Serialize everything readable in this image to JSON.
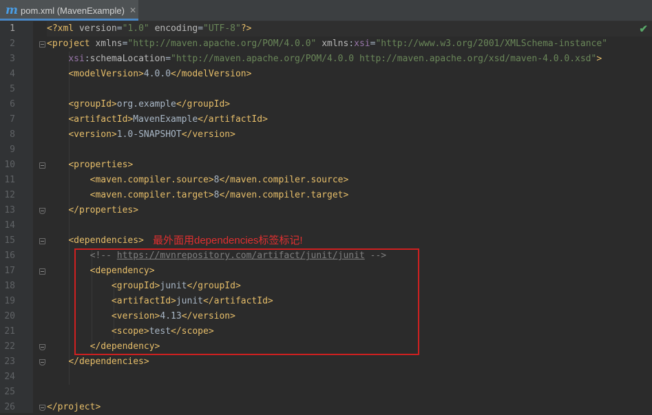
{
  "tab": {
    "icon": "maven-m-icon",
    "icon_glyph": "m",
    "title": "pom.xml (MavenExample)",
    "close_glyph": "✕"
  },
  "editor": {
    "status_glyph": "✔",
    "annotation": "最外面用dependencies标签标记!",
    "lines": [
      {
        "n": "1",
        "tokens": [
          [
            "tag",
            "<?xml "
          ],
          [
            "attr",
            "version"
          ],
          [
            "txt",
            "="
          ],
          [
            "val",
            "\"1.0\""
          ],
          [
            "txt",
            " "
          ],
          [
            "attr",
            "encoding"
          ],
          [
            "txt",
            "="
          ],
          [
            "val",
            "\"UTF-8\""
          ],
          [
            "tag",
            "?>"
          ]
        ]
      },
      {
        "n": "2",
        "tokens": [
          [
            "tag",
            "<project "
          ],
          [
            "attr",
            "xmlns"
          ],
          [
            "txt",
            "="
          ],
          [
            "val",
            "\"http://maven.apache.org/POM/4.0.0\""
          ],
          [
            "txt",
            " "
          ],
          [
            "attr",
            "xmlns"
          ],
          [
            "txt",
            ":"
          ],
          [
            "ns",
            "xsi"
          ],
          [
            "txt",
            "="
          ],
          [
            "val",
            "\"http://www.w3.org/2001/XMLSchema-instance\""
          ]
        ]
      },
      {
        "n": "3",
        "tokens": [
          [
            "txt",
            "    "
          ],
          [
            "ns",
            "xsi"
          ],
          [
            "txt",
            ":"
          ],
          [
            "attr",
            "schemaLocation"
          ],
          [
            "txt",
            "="
          ],
          [
            "val",
            "\"http://maven.apache.org/POM/4.0.0 http://maven.apache.org/xsd/maven-4.0.0.xsd\""
          ],
          [
            "tag",
            ">"
          ]
        ]
      },
      {
        "n": "4",
        "tokens": [
          [
            "txt",
            "    "
          ],
          [
            "tag",
            "<modelVersion>"
          ],
          [
            "txt",
            "4.0.0"
          ],
          [
            "tag",
            "</modelVersion>"
          ]
        ]
      },
      {
        "n": "5",
        "tokens": []
      },
      {
        "n": "6",
        "tokens": [
          [
            "txt",
            "    "
          ],
          [
            "tag",
            "<groupId>"
          ],
          [
            "txt",
            "org.example"
          ],
          [
            "tag",
            "</groupId>"
          ]
        ]
      },
      {
        "n": "7",
        "tokens": [
          [
            "txt",
            "    "
          ],
          [
            "tag",
            "<artifactId>"
          ],
          [
            "txt",
            "MavenExample"
          ],
          [
            "tag",
            "</artifactId>"
          ]
        ]
      },
      {
        "n": "8",
        "tokens": [
          [
            "txt",
            "    "
          ],
          [
            "tag",
            "<version>"
          ],
          [
            "txt",
            "1.0-SNAPSHOT"
          ],
          [
            "tag",
            "</version>"
          ]
        ]
      },
      {
        "n": "9",
        "tokens": []
      },
      {
        "n": "10",
        "tokens": [
          [
            "txt",
            "    "
          ],
          [
            "tag",
            "<properties>"
          ]
        ]
      },
      {
        "n": "11",
        "tokens": [
          [
            "txt",
            "        "
          ],
          [
            "tag",
            "<maven.compiler.source>"
          ],
          [
            "txt",
            "8"
          ],
          [
            "tag",
            "</maven.compiler.source>"
          ]
        ]
      },
      {
        "n": "12",
        "tokens": [
          [
            "txt",
            "        "
          ],
          [
            "tag",
            "<maven.compiler.target>"
          ],
          [
            "txt",
            "8"
          ],
          [
            "tag",
            "</maven.compiler.target>"
          ]
        ]
      },
      {
        "n": "13",
        "tokens": [
          [
            "txt",
            "    "
          ],
          [
            "tag",
            "</properties>"
          ]
        ]
      },
      {
        "n": "14",
        "tokens": []
      },
      {
        "n": "15",
        "tokens": [
          [
            "txt",
            "    "
          ],
          [
            "tag",
            "<dependencies>"
          ]
        ]
      },
      {
        "n": "16",
        "tokens": [
          [
            "txt",
            "        "
          ],
          [
            "comment",
            "<!-- "
          ],
          [
            "link",
            "https://mvnrepository.com/artifact/junit/junit"
          ],
          [
            "comment",
            " -->"
          ]
        ]
      },
      {
        "n": "17",
        "tokens": [
          [
            "txt",
            "        "
          ],
          [
            "tag",
            "<dependency>"
          ]
        ]
      },
      {
        "n": "18",
        "tokens": [
          [
            "txt",
            "            "
          ],
          [
            "tag",
            "<groupId>"
          ],
          [
            "txt",
            "junit"
          ],
          [
            "tag",
            "</groupId>"
          ]
        ]
      },
      {
        "n": "19",
        "tokens": [
          [
            "txt",
            "            "
          ],
          [
            "tag",
            "<artifactId>"
          ],
          [
            "txt",
            "junit"
          ],
          [
            "tag",
            "</artifactId>"
          ]
        ]
      },
      {
        "n": "20",
        "tokens": [
          [
            "txt",
            "            "
          ],
          [
            "tag",
            "<version>"
          ],
          [
            "txt",
            "4.13"
          ],
          [
            "tag",
            "</version>"
          ]
        ]
      },
      {
        "n": "21",
        "tokens": [
          [
            "txt",
            "            "
          ],
          [
            "tag",
            "<scope>"
          ],
          [
            "txt",
            "test"
          ],
          [
            "tag",
            "</scope>"
          ]
        ]
      },
      {
        "n": "22",
        "tokens": [
          [
            "txt",
            "        "
          ],
          [
            "tag",
            "</dependency>"
          ]
        ]
      },
      {
        "n": "23",
        "tokens": [
          [
            "txt",
            "    "
          ],
          [
            "tag",
            "</dependencies>"
          ]
        ]
      },
      {
        "n": "24",
        "tokens": []
      },
      {
        "n": "25",
        "tokens": []
      },
      {
        "n": "26",
        "tokens": [
          [
            "tag",
            "</project>"
          ]
        ]
      }
    ]
  }
}
